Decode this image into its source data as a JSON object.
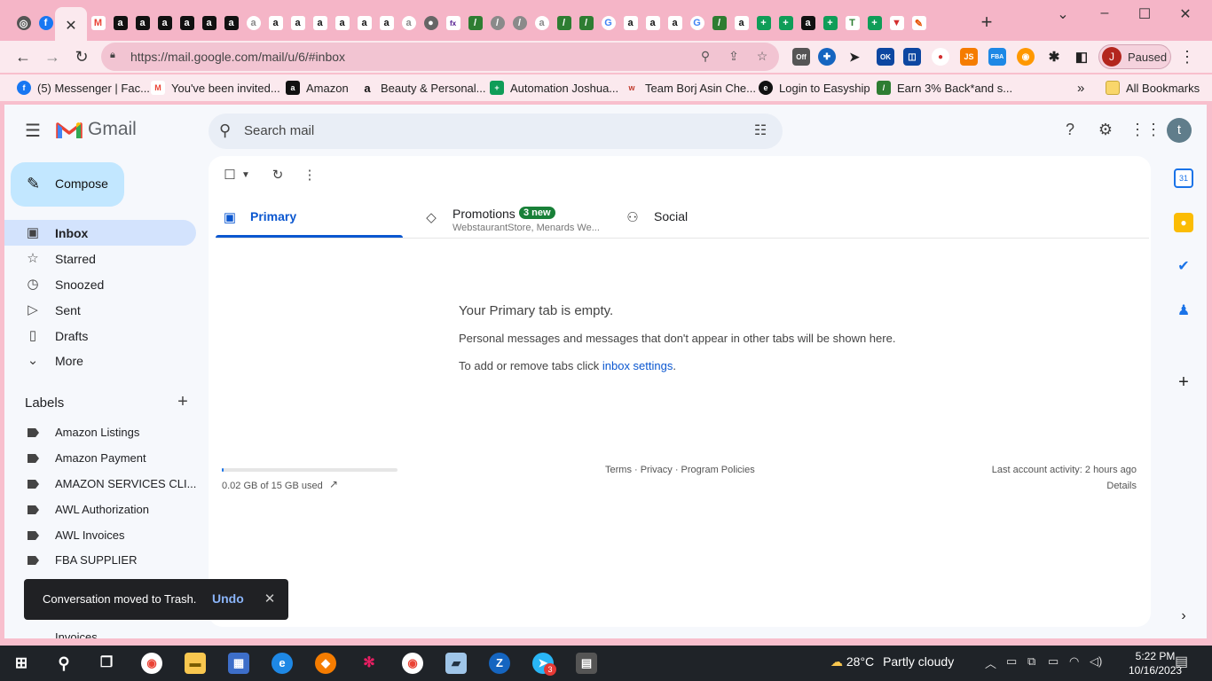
{
  "browser": {
    "url": "https://mail.google.com/mail/u/6/#inbox",
    "active_tab_close": "✕",
    "profile_initial": "J",
    "profile_status": "Paused",
    "bookmarks": [
      {
        "label": "(5) Messenger | Fac...",
        "icon": "facebook-icon",
        "color": "#1877f2",
        "glyph": "f"
      },
      {
        "label": "You've been invited...",
        "icon": "gmail-icon",
        "color": "#ea4335",
        "glyph": "M"
      },
      {
        "label": "Amazon",
        "icon": "amazon-icon",
        "color": "#111111",
        "glyph": "a"
      },
      {
        "label": "Beauty & Personal...",
        "icon": "amazon-icon",
        "color": "#f5b5c7",
        "glyph": "a"
      },
      {
        "label": "Automation Joshua...",
        "icon": "sheets-icon",
        "color": "#0f9d58",
        "glyph": "+"
      },
      {
        "label": "Team Borj Asin Che...",
        "icon": "team-icon",
        "color": "#c0392b",
        "glyph": "w"
      },
      {
        "label": "Login to Easyship",
        "icon": "easyship-icon",
        "color": "#111111",
        "glyph": "e"
      },
      {
        "label": "Earn 3% Back*and s...",
        "icon": "cashback-icon",
        "color": "#2e7d32",
        "glyph": "//"
      }
    ],
    "all_bookmarks": "All Bookmarks"
  },
  "gmail": {
    "brand": "Gmail",
    "search_placeholder": "Search mail",
    "compose": "Compose",
    "nav": [
      {
        "label": "Inbox",
        "icon": "inbox-icon",
        "glyph": "▣",
        "active": true
      },
      {
        "label": "Starred",
        "icon": "star-icon",
        "glyph": "☆"
      },
      {
        "label": "Snoozed",
        "icon": "clock-icon",
        "glyph": "◷"
      },
      {
        "label": "Sent",
        "icon": "send-icon",
        "glyph": "▷"
      },
      {
        "label": "Drafts",
        "icon": "draft-icon",
        "glyph": "▯"
      },
      {
        "label": "More",
        "icon": "chevron-down-icon",
        "glyph": "⌄"
      }
    ],
    "labels_title": "Labels",
    "labels": [
      "Amazon Listings",
      "Amazon Payment",
      "AMAZON SERVICES CLI...",
      "AWL Authorization",
      "AWL Invoices",
      "FBA SUPPLIER"
    ],
    "cut_label": "Invoices",
    "tabs": {
      "primary": "Primary",
      "promotions": "Promotions",
      "promotions_badge": "3 new",
      "promotions_sub": "WebstaurantStore, Menards We...",
      "social": "Social"
    },
    "empty": {
      "title": "Your Primary tab is empty.",
      "desc": "Personal messages and messages that don't appear in other tabs will be shown here.",
      "hint_prefix": "To add or remove tabs click ",
      "hint_link": "inbox settings",
      "hint_suffix": "."
    },
    "storage": {
      "text": "0.02 GB of 15 GB used",
      "fraction": 0.0013
    },
    "footer_links": "Terms · Privacy · Program Policies",
    "last_activity": "Last account activity: 2 hours ago",
    "details": "Details",
    "account_initial": "t",
    "snackbar": {
      "message": "Conversation moved to Trash.",
      "undo": "Undo"
    }
  },
  "taskbar": {
    "weather_temp": "28°C",
    "weather_desc": "Partly cloudy",
    "time": "5:22 PM",
    "date": "10/16/2023",
    "telegram_badge": "3"
  }
}
